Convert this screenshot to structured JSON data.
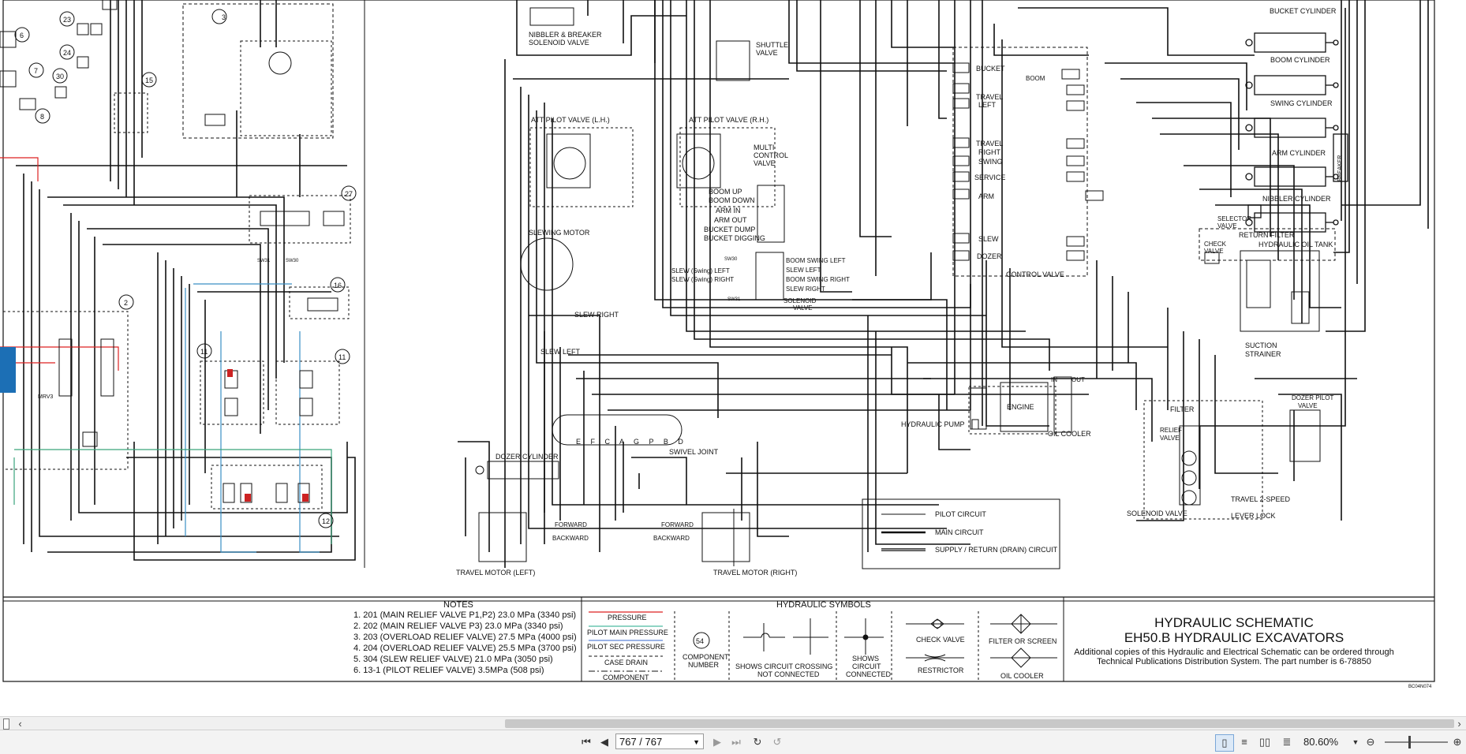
{
  "document": {
    "title_block": {
      "line1": "HYDRAULIC SCHEMATIC",
      "line2": "EH50.B HYDRAULIC EXCAVATORS",
      "line3": "Additional copies of this Hydraulic and Electrical Schematic can be ordered through",
      "line4": "Technical Publications Distribution System. The part number is 6-78850",
      "code": "BC04N074"
    },
    "notes": {
      "heading": "NOTES",
      "items": [
        "1.  201 (MAIN RELIEF VALVE P1,P2) 23.0 MPa (3340 psi)",
        "2.  202 (MAIN RELIEF VALVE P3) 23.0 MPa (3340 psi)",
        "3.  203 (OVERLOAD RELIEF VALVE) 27.5 MPa (4000 psi)",
        "4.  204 (OVERLOAD RELIEF VALVE) 25.5 MPa (3700 psi)",
        "5.  304 (SLEW RELIEF VALVE) 21.0 MPa (3050 psi)",
        "6.  13-1 (PILOT RELIEF VALVE) 3.5MPa (508 psi)"
      ]
    },
    "symbols": {
      "heading": "HYDRAULIC SYMBOLS",
      "pressure": "PRESSURE",
      "pilot_main": "PILOT MAIN PRESSURE",
      "pilot_sec": "PILOT SEC PRESSURE",
      "case_drain": "CASE DRAIN",
      "component": "COMPONENT",
      "component_number_val": "54",
      "component_number_l1": "COMPONENT",
      "component_number_l2": "NUMBER",
      "crossing_l1": "SHOWS CIRCUIT CROSSING",
      "crossing_l2": "NOT CONNECTED",
      "connected_l1": "SHOWS",
      "connected_l2": "CIRCUIT",
      "connected_l3": "CONNECTED",
      "check_valve": "CHECK VALVE",
      "restrictor": "RESTRICTOR",
      "filter": "FILTER OR SCREEN",
      "oil_cooler": "OIL COOLER"
    },
    "line_legend": {
      "pilot": "PILOT CIRCUIT",
      "main": "MAIN CIRCUIT",
      "supply": "SUPPLY / RETURN (DRAIN) CIRCUIT"
    },
    "labels": {
      "nibbler_breaker_1": "NIBBLER & BREAKER",
      "nibbler_breaker_2": "SOLENOID VALVE",
      "shuttle_1": "SHUTTLE",
      "shuttle_2": "VALVE",
      "att_lh": "ATT PILOT VALVE (L.H.)",
      "att_rh": "ATT PILOT VALVE (R.H.)",
      "multi_1": "MULTI",
      "multi_2": "CONTROL",
      "multi_3": "VALVE",
      "boom_up": "BOOM UP",
      "boom_down": "BOOM DOWN",
      "arm_in": "ARM IN",
      "arm_out": "ARM OUT",
      "bucket_dump": "BUCKET DUMP",
      "bucket_digging": "BUCKET DIGGING",
      "slewing_motor": "SLEWING MOTOR",
      "slew_swing_left": "SLEW (Swing) LEFT",
      "slew_swing_right": "SLEW (Swing) RIGHT",
      "boom_swing_left": "BOOM SWING LEFT",
      "slew_left_sv": "SLEW LEFT",
      "boom_swing_right": "BOOM SWING RIGHT",
      "slew_right_sv": "SLEW RIGHT",
      "solenoid_valve_1": "SOLENOID",
      "solenoid_valve_2": "VALVE",
      "slew_right_arrow": "SLEW RIGHT",
      "slew_left_arrow": "SLEW LEFT",
      "bucket": "BUCKET",
      "boom": "BOOM",
      "travel_left_1": "TRAVEL",
      "travel_left_2": "LEFT",
      "travel_right_1": "TRAVEL",
      "travel_right_2": "RIGHT",
      "swing": "SWING",
      "service": "SERVICE",
      "arm": "ARM",
      "slew": "SLEW",
      "dozer": "DOZER",
      "control_valve": "CONTROL VALVE",
      "bucket_cyl": "BUCKET CYLINDER",
      "boom_cyl": "BOOM CYLINDER",
      "swing_cyl": "SWING CYLINDER",
      "arm_cyl": "ARM CYLINDER",
      "nibbler_cyl": "NIBBLER CYLINDER",
      "selector_valve_1": "SELECTOR",
      "selector_valve_2": "VALVE",
      "return_filter": "RETURN FILTER",
      "check_valve_1": "CHECK",
      "check_valve_2": "VALVE",
      "tank": "HYDRAULIC OIL TANK",
      "suction_1": "SUCTION",
      "suction_2": "STRAINER",
      "engine": "ENGINE",
      "hydraulic_pump": "HYDRAULIC PUMP",
      "oil_cooler": "OIL COOLER",
      "in": "IN",
      "out": "OUT",
      "filter": "FILTER",
      "relief_valve_1": "RELIEF",
      "relief_valve_2": "VALVE",
      "dozer_pilot_1": "DOZER PILOT",
      "dozer_pilot_2": "VALVE",
      "travel_2speed": "TRAVEL 2-SPEED",
      "lever_lock": "LEVER LOCK",
      "solenoid_valve_b": "SOLENOID VALVE",
      "dozer_cylinder": "DOZER CYLINDER",
      "swivel_joint": "SWIVEL JOINT",
      "swivel_ports": "E F C A G P B D",
      "forward": "FORWARD",
      "backward": "BACKWARD",
      "travel_motor_left": "TRAVEL MOTOR (LEFT)",
      "travel_motor_right": "TRAVEL MOTOR (RIGHT)",
      "breaker": "BREAKER",
      "sw30": "SW30",
      "sw31": "SW31",
      "mrv3": "MRV3"
    },
    "callouts": [
      "3",
      "6",
      "7",
      "8",
      "15",
      "23",
      "24",
      "30",
      "27",
      "16",
      "11",
      "11",
      "2",
      "12"
    ]
  },
  "toolbar": {
    "page_value": "767 / 767",
    "zoom": "80.60%"
  }
}
